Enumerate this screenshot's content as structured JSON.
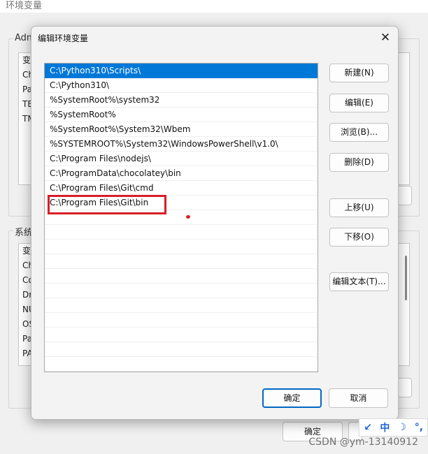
{
  "background_window": {
    "title": "环境变量",
    "user_group_label": "Adm",
    "user_vars": [
      "变",
      "Ch",
      "Pa",
      "TE",
      "TM"
    ],
    "system_group_label": "系统",
    "system_vars": [
      "变",
      "Ch",
      "Co",
      "Dr",
      "NU",
      "OS",
      "Pa",
      "PA"
    ],
    "ok_label": "确定"
  },
  "dialog": {
    "title": "编辑环境变量",
    "close_glyph": "✕",
    "paths": [
      "C:\\Python310\\Scripts\\",
      "C:\\Python310\\",
      "%SystemRoot%\\system32",
      "%SystemRoot%",
      "%SystemRoot%\\System32\\Wbem",
      "%SYSTEMROOT%\\System32\\WindowsPowerShell\\v1.0\\",
      "C:\\Program Files\\nodejs\\",
      "C:\\ProgramData\\chocolatey\\bin",
      "C:\\Program Files\\Git\\cmd",
      "C:\\Program Files\\Git\\bin"
    ],
    "buttons": {
      "new": "新建(N)",
      "edit": "编辑(E)",
      "browse": "浏览(B)...",
      "delete": "删除(D)",
      "move_up": "上移(U)",
      "move_down": "下移(O)",
      "edit_text": "编辑文本(T)...",
      "ok": "确定",
      "cancel": "取消"
    }
  },
  "ime_toolbar": {
    "items": [
      "↙",
      "中",
      "☽",
      "°,"
    ]
  },
  "watermark": "CSDN @ym-13140912",
  "colors": {
    "selection": "#0078d7",
    "annotation": "#d81e28",
    "primary_border": "#0067c0"
  }
}
